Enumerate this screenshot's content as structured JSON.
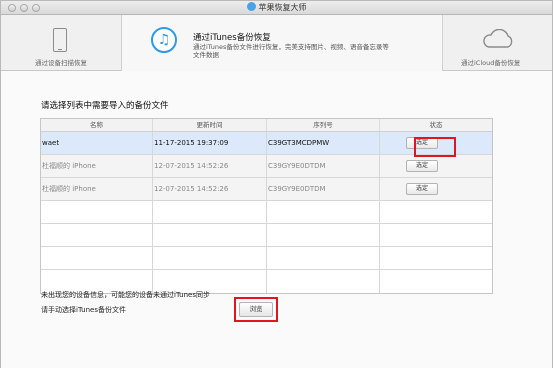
{
  "window": {
    "title": "苹果恢复大师"
  },
  "tabs": [
    {
      "label": "通过设备扫描恢复",
      "icon": "phone-icon"
    },
    {
      "title": "通过iTunes备份恢复",
      "description": "通过iTunes备份文件进行恢复，完美支持图片、视频、语音备忘录等文件数据",
      "icon": "music-note-icon",
      "active": true
    },
    {
      "label": "通过iCloud备份恢复",
      "icon": "cloud-icon"
    }
  ],
  "main": {
    "section_title": "请选择列表中需要导入的备份文件",
    "table": {
      "columns": [
        "名称",
        "更新时间",
        "序列号",
        "状态"
      ],
      "rows": [
        {
          "name": "waet",
          "time": "11-17-2015 19:37:09",
          "serial": "C39GT3MCDPMW",
          "action": "选定"
        },
        {
          "name": "杜福顺的 iPhone",
          "time": "12-07-2015 14:52:26",
          "serial": "C39GY9E0DTDM",
          "action": "选定"
        },
        {
          "name": "杜福顺的 iPhone",
          "time": "12-07-2015 14:52:26",
          "serial": "C39GY9E0DTDM",
          "action": "选定"
        }
      ]
    },
    "hint_line1": "未出现您的设备信息，可能您的设备未通过iTunes同步",
    "hint_line2": "请手动选择iTunes备份文件",
    "browse_label": "浏览"
  },
  "colors": {
    "accent": "#2e9ae6",
    "highlight_box": "#e0151e",
    "selected_row": "#dce9fa"
  }
}
